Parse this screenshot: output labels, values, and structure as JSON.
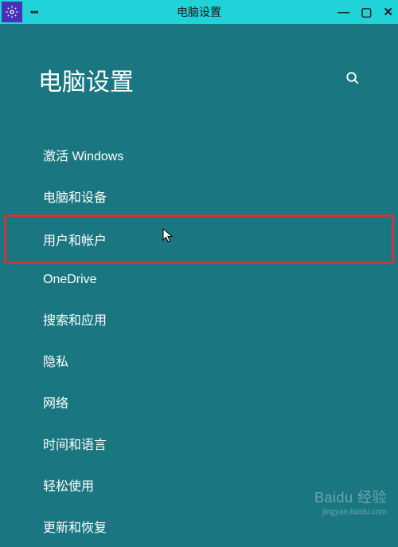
{
  "titlebar": {
    "title": "电脑设置",
    "menu_dots": "•••"
  },
  "header": {
    "page_title": "电脑设置"
  },
  "menu": {
    "items": [
      {
        "label": "激活 Windows",
        "highlighted": false
      },
      {
        "label": "电脑和设备",
        "highlighted": false
      },
      {
        "label": "用户和帐户",
        "highlighted": true
      },
      {
        "label": "OneDrive",
        "highlighted": false
      },
      {
        "label": "搜索和应用",
        "highlighted": false
      },
      {
        "label": "隐私",
        "highlighted": false
      },
      {
        "label": "网络",
        "highlighted": false
      },
      {
        "label": "时间和语言",
        "highlighted": false
      },
      {
        "label": "轻松使用",
        "highlighted": false
      },
      {
        "label": "更新和恢复",
        "highlighted": false
      }
    ]
  },
  "watermark": {
    "logo": "Baidu 经验",
    "sub": "jingyan.baidu.com"
  }
}
